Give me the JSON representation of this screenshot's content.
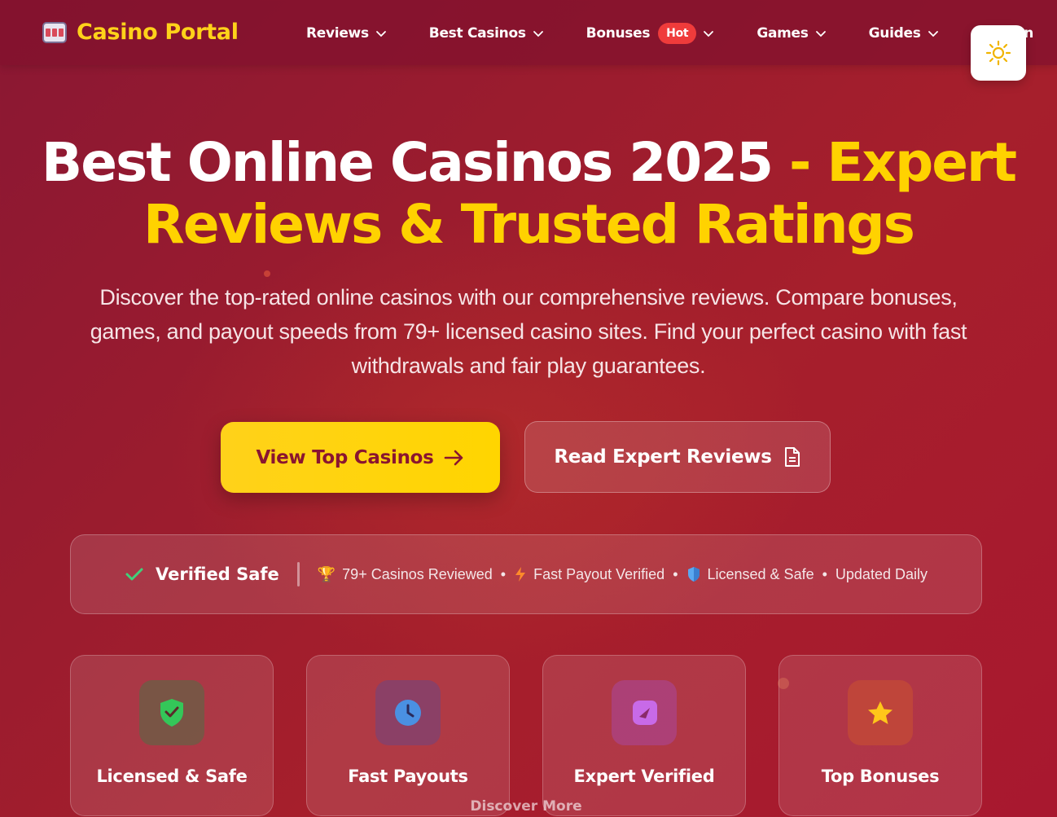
{
  "header": {
    "logo_text": "Casino Portal",
    "nav": [
      {
        "label": "Reviews"
      },
      {
        "label": "Best Casinos"
      },
      {
        "label": "Bonuses",
        "badge": "Hot"
      },
      {
        "label": "Games"
      },
      {
        "label": "Guides"
      },
      {
        "label": "Region"
      }
    ],
    "theme_toggle_icon": "sun-icon"
  },
  "hero": {
    "title_main": "Best Online Casinos 2025",
    "title_accent_1": " - Expert",
    "title_accent_2": "Reviews & Trusted Ratings",
    "subtitle": "Discover the top-rated online casinos with our comprehensive reviews. Compare bonuses, games, and payout speeds from 79+ licensed casino sites. Find your perfect casino with fast withdrawals and fair play guarantees.",
    "primary_button": "View Top Casinos",
    "secondary_button": "Read Expert Reviews"
  },
  "trust_bar": {
    "verified_label": "Verified Safe",
    "items": [
      {
        "icon": "trophy-icon",
        "text": "79+ Casinos Reviewed"
      },
      {
        "icon": "lightning-icon",
        "text": "Fast Payout Verified"
      },
      {
        "icon": "shield-icon",
        "text": "Licensed & Safe"
      },
      {
        "icon": "",
        "text": "Updated Daily"
      }
    ]
  },
  "features": [
    {
      "label": "Licensed & Safe",
      "icon": "shield-check-icon",
      "color": "#34c759"
    },
    {
      "label": "Fast Payouts",
      "icon": "clock-icon",
      "color": "#4a90e2"
    },
    {
      "label": "Expert Verified",
      "icon": "badge-icon",
      "color": "#c86ae8"
    },
    {
      "label": "Top Bonuses",
      "icon": "star-icon",
      "color": "#ffc61a"
    }
  ],
  "discover_more": "Discover More",
  "colors": {
    "accent": "#ffd200",
    "background": "#9b1c2e",
    "hot_badge": "#ef3b3b"
  }
}
